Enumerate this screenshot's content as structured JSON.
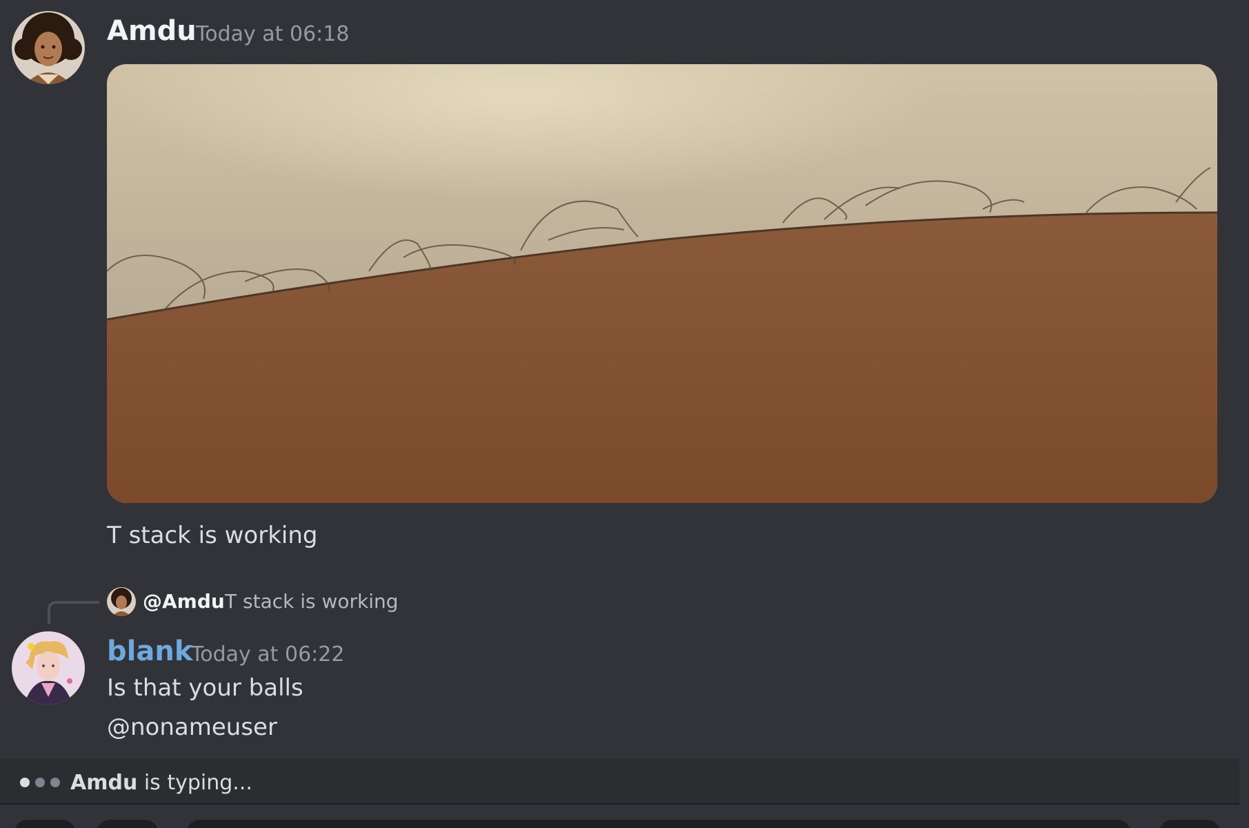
{
  "colors": {
    "background": "#313338",
    "text": "#dbdee1",
    "muted": "#949ba4",
    "amdu_name": "#f2f3f5",
    "blank_name": "#6fa8dc",
    "typing_bar": "#2b2d31"
  },
  "messages": [
    {
      "author": "Amdu",
      "timestamp": "Today at 06:18",
      "avatar_icon": "curly-hair-man-avatar",
      "attachment": "photo-attachment",
      "text": "T stack is working"
    },
    {
      "author": "blank",
      "timestamp": "Today at 06:22",
      "avatar_icon": "anime-character-avatar",
      "reply": {
        "author": "@Amdu",
        "text": "T stack is working"
      },
      "text": "Is that your balls",
      "mention": "@nonameuser"
    }
  ],
  "typing": {
    "user": "Amdu",
    "suffix": " is typing..."
  }
}
